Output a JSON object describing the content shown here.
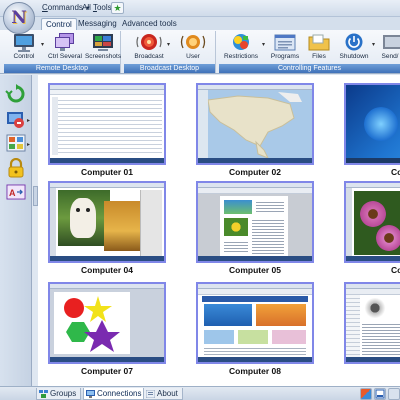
{
  "quick_access": {
    "commands_label": "Commands",
    "commands_hotkey": "C",
    "tools_label": "All Tools",
    "tools_hotkey": "T"
  },
  "tabs": [
    {
      "label": "Control",
      "active": true
    },
    {
      "label": "Messaging",
      "active": false
    },
    {
      "label": "Advanced tools",
      "active": false
    }
  ],
  "ribbon": {
    "groups": [
      {
        "label": "Remote Desktop"
      },
      {
        "label": "Broadcast Desktop"
      },
      {
        "label": "Controlling Features"
      }
    ],
    "buttons": {
      "control": "Control",
      "ctrl_several": "Ctrl Several",
      "screenshots": "Screenshots",
      "broadcast": "Broadcast",
      "user": "User",
      "restrictions": "Restrictions",
      "programs": "Programs",
      "files": "Files",
      "shutdown": "Shutdown",
      "send": "Send/"
    }
  },
  "computers": [
    {
      "name": "Computer 01",
      "screen": "spreadsheet"
    },
    {
      "name": "Computer 02",
      "screen": "map"
    },
    {
      "name": "Comp",
      "screen": "desktop"
    },
    {
      "name": "Computer 04",
      "screen": "photo-editor"
    },
    {
      "name": "Computer 05",
      "screen": "document"
    },
    {
      "name": "Comp",
      "screen": "flower-photo"
    },
    {
      "name": "Computer 07",
      "screen": "paint"
    },
    {
      "name": "Computer 08",
      "screen": "website"
    },
    {
      "name": "",
      "screen": "browser"
    }
  ],
  "bottom_tabs": [
    {
      "label": "Groups",
      "active": false
    },
    {
      "label": "Connections",
      "active": true
    },
    {
      "label": "About",
      "active": false
    }
  ],
  "colors": {
    "thumb_border": "#8087e8",
    "group_label": "#3f71b8",
    "ribbon_bg": "#e2e9f3"
  }
}
